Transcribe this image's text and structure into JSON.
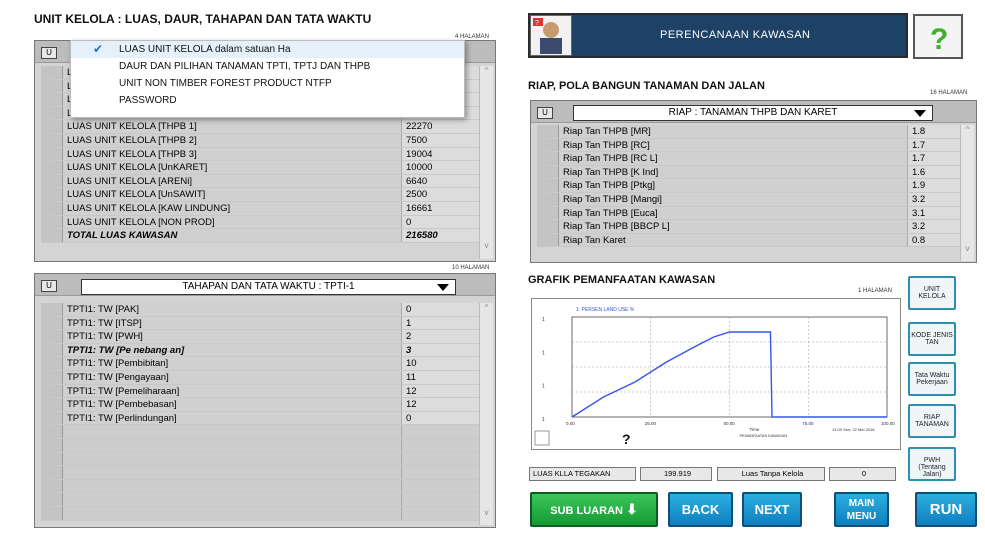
{
  "left": {
    "title": "UNIT KELOLA : LUAS, DAUR, TAHAPAN DAN TATA WAKTU",
    "pages_top": "4 HALAMAN",
    "popup": {
      "items": [
        "LUAS UNIT KELOLA  dalam satuan Ha",
        "DAUR DAN PILIHAN TANAMAN TPTI, TPTJ DAN THPB",
        "UNIT NON TIMBER FOREST PRODUCT NTFP",
        "PASSWORD"
      ]
    },
    "top_rows": [
      {
        "label": "LU",
        "value": ""
      },
      {
        "label": "LU",
        "value": ""
      },
      {
        "label": "LU",
        "value": ""
      },
      {
        "label": "LU",
        "value": ""
      },
      {
        "label": "LUAS UNIT KELOLA      [THPB 1]",
        "value": "22270"
      },
      {
        "label": "LUAS UNIT KELOLA      [THPB 2]",
        "value": "7500"
      },
      {
        "label": "LUAS UNIT KELOLA      [THPB 3]",
        "value": "19004"
      },
      {
        "label": "LUAS UNIT KELOLA      [UnKARET]",
        "value": "10000"
      },
      {
        "label": "LUAS UNIT KELOLA      [ARENi]",
        "value": "6640"
      },
      {
        "label": "LUAS UNIT KELOLA      [UnSAWIT]",
        "value": "2500"
      },
      {
        "label": "LUAS UNIT KELOLA      [KAW LINDUNG]",
        "value": "16661"
      },
      {
        "label": "LUAS UNIT KELOLA      [NON PROD]",
        "value": "0"
      },
      {
        "label": "TOTAL LUAS KAWASAN",
        "value": "216580"
      }
    ],
    "pages_bottom": "10 HALAMAN",
    "dropdown": "TAHAPAN DAN TATA WAKTU : TPTI-1",
    "bottom_rows": [
      {
        "label": "TPTI1: TW [PAK]",
        "value": "0"
      },
      {
        "label": "TPTI1: TW [ITSP]",
        "value": "1"
      },
      {
        "label": "TPTI1: TW [PWH]",
        "value": "2"
      },
      {
        "label": "TPTI1: TW [Pe nebang an]",
        "value": "3"
      },
      {
        "label": "TPTI1: TW [Pembibitan]",
        "value": "10"
      },
      {
        "label": "TPTI1: TW [Pengayaan]",
        "value": "11"
      },
      {
        "label": "TPTI1: TW [Pemeliharaan]",
        "value": "12"
      },
      {
        "label": "TPTI1: TW [Pembebasan]",
        "value": "12"
      },
      {
        "label": "TPTI1: TW [Perlindungan]",
        "value": "0"
      }
    ]
  },
  "right": {
    "banner": "PERENCANAAN KAWASAN",
    "riap_title": "RIAP, POLA  BANGUN TANAMAN DAN JALAN",
    "riap_pages": "16 HALAMAN",
    "riap_dropdown": "RIAP : TANAMAN THPB DAN KARET",
    "riap_rows": [
      {
        "label": "Riap Tan THPB  [MR]",
        "value": "1.8"
      },
      {
        "label": "Riap Tan THPB  [RC]",
        "value": "1.7"
      },
      {
        "label": "Riap Tan THPB  [RC L]",
        "value": "1.7"
      },
      {
        "label": "Riap Tan THPB  [K Ind]",
        "value": "1.6"
      },
      {
        "label": "Riap Tan THPB  [Ptkg]",
        "value": "1.9"
      },
      {
        "label": "Riap Tan THPB  [Mangi]",
        "value": "3.2"
      },
      {
        "label": "Riap Tan THPB  [Euca]",
        "value": "3.1"
      },
      {
        "label": "Riap Tan THPB  [BBCP L]",
        "value": "3.2"
      },
      {
        "label": "Riap Tan Karet",
        "value": "0.8"
      }
    ],
    "grafik_title": "GRAFIK PEMANFAATAN KAWASAN",
    "grafik_pages": "1 HALAMAN",
    "luas_kla_label": "LUAS KLLA TEGAKAN",
    "luas_kla_value": "199.919",
    "luas_tanpa_label": "Luas Tanpa Kelola",
    "luas_tanpa_value": "0",
    "side_buttons": [
      "UNIT KELOLA",
      "KODE JENIS TAN",
      "Tata Waktu Pekerjaan",
      "RIAP TANAMAN",
      "PWH (Tentang Jalan)"
    ],
    "buttons": {
      "sub_luaran": "SUB LUARAN",
      "back": "BACK",
      "next": "NEXT",
      "main_menu": "MAIN MENU",
      "run": "RUN"
    }
  },
  "chart_data": {
    "type": "line",
    "series": [
      {
        "x": [
          0,
          10,
          20,
          30,
          40,
          45,
          50,
          55,
          60,
          63,
          63.5,
          70,
          80,
          100
        ],
        "y": [
          0,
          20,
          35,
          55,
          72,
          80,
          85,
          85,
          85,
          85,
          0,
          0,
          0,
          0
        ]
      }
    ],
    "xlim": [
      0,
      100
    ],
    "ylim": [
      0,
      100
    ],
    "xticks": [
      "0.00",
      "25.00",
      "50.00",
      "75.00",
      "100.00"
    ],
    "yticks": [
      "1",
      "1",
      "1",
      "1"
    ],
    "title": "1: PERSEN LAND USE %",
    "xlabel": "Time",
    "annotation_top": "PEMANFAATAN KAWASAN",
    "footer_left": "?",
    "footer_right": "13.00  Sen, 22 Mei 2018",
    "color": "#3355ee"
  }
}
